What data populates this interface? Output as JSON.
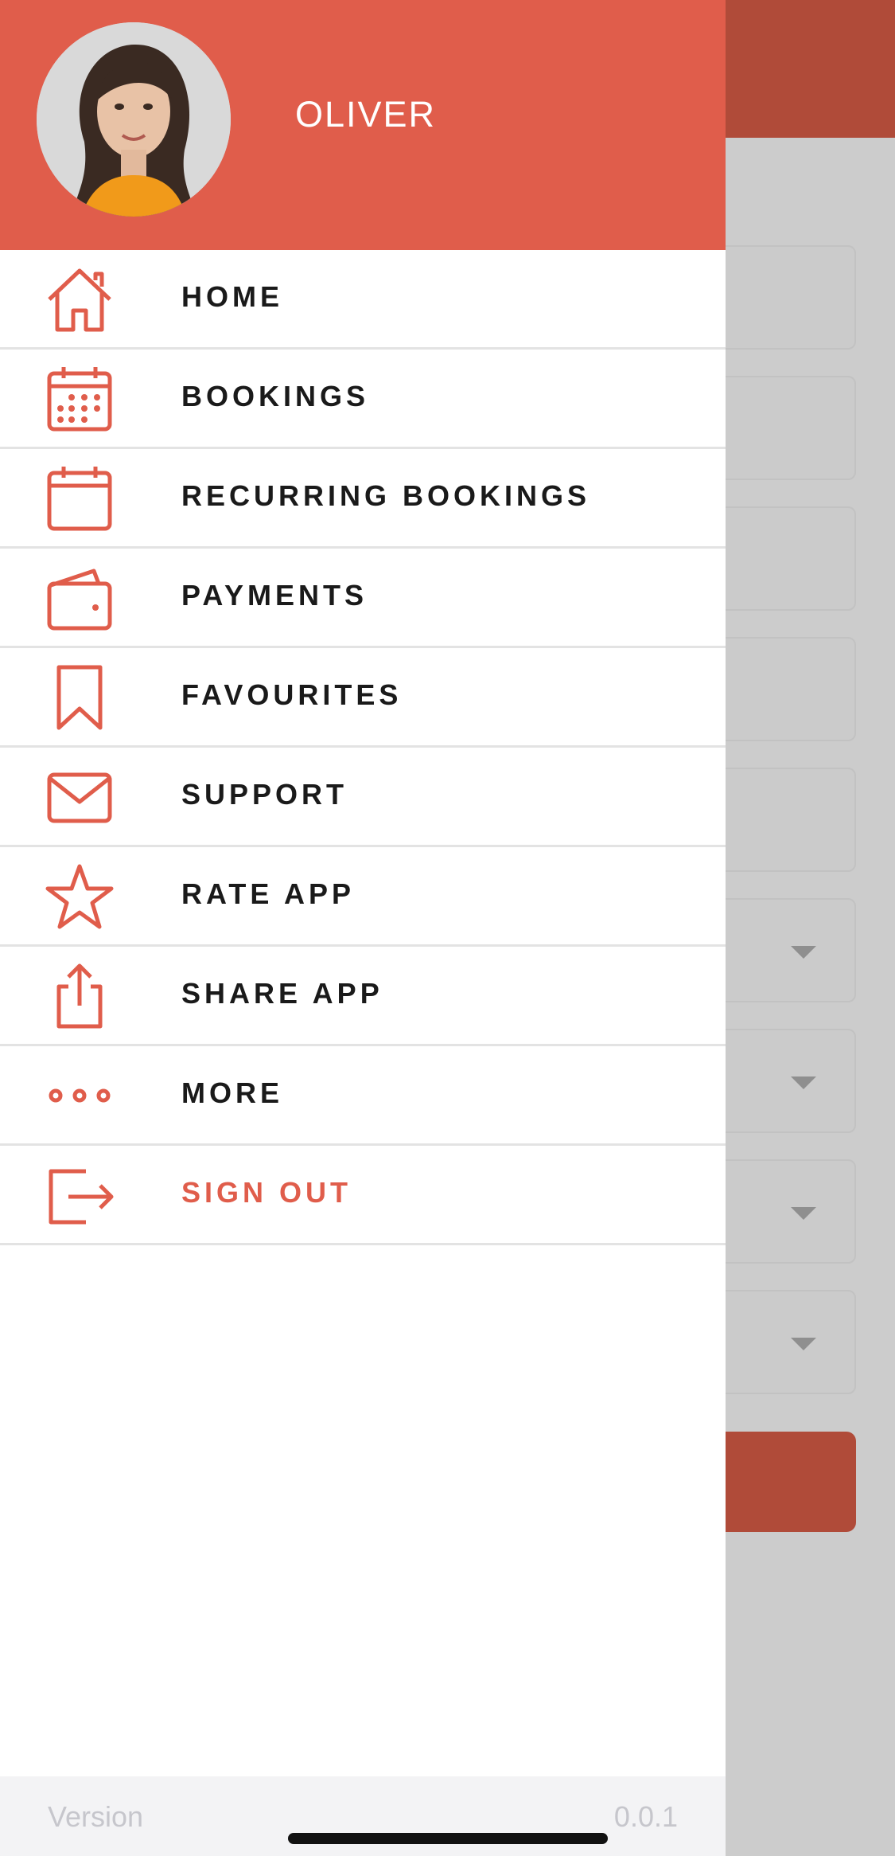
{
  "user": {
    "name": "OLIVER"
  },
  "menu": {
    "items": [
      {
        "label": "HOME",
        "icon": "home-icon"
      },
      {
        "label": "BOOKINGS",
        "icon": "calendar-grid-icon"
      },
      {
        "label": "RECURRING BOOKINGS",
        "icon": "calendar-icon"
      },
      {
        "label": "PAYMENTS",
        "icon": "wallet-icon"
      },
      {
        "label": "FAVOURITES",
        "icon": "bookmark-icon"
      },
      {
        "label": "SUPPORT",
        "icon": "mail-icon"
      },
      {
        "label": "RATE APP",
        "icon": "star-icon"
      },
      {
        "label": "SHARE APP",
        "icon": "share-icon"
      },
      {
        "label": "MORE",
        "icon": "more-dots-icon"
      },
      {
        "label": "SIGN OUT",
        "icon": "sign-out-icon"
      }
    ]
  },
  "footer": {
    "version_label": "Version",
    "version_value": "0.0.1"
  },
  "colors": {
    "accent": "#e05d4b",
    "accent_dark": "#b04b39",
    "text": "#1a1a1a",
    "overlay": "#cccccc"
  }
}
